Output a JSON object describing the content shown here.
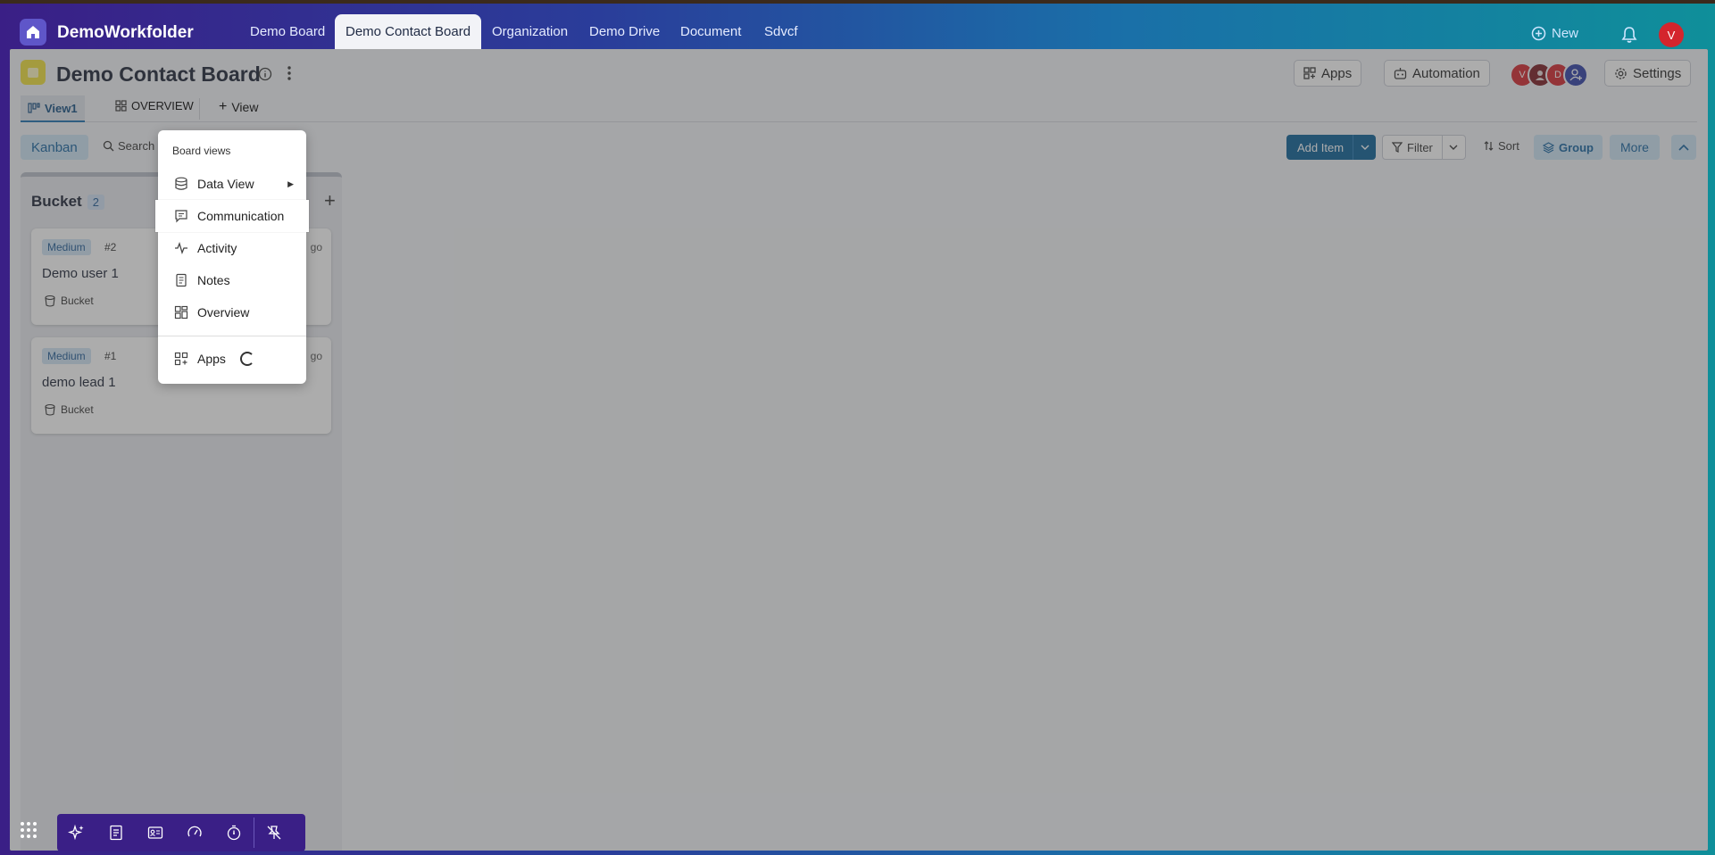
{
  "nav": {
    "brand": "DemoWorkfolder",
    "tabs": [
      {
        "label": "Demo Board"
      },
      {
        "label": "Demo Contact Board"
      },
      {
        "label": "Organization"
      },
      {
        "label": "Demo Drive"
      },
      {
        "label": "Document"
      },
      {
        "label": "Sdvcf"
      }
    ],
    "new_label": "New",
    "user_initial": "V"
  },
  "board": {
    "title": "Demo Contact Board",
    "apps_label": "Apps",
    "automation_label": "Automation",
    "settings_label": "Settings",
    "members": [
      {
        "initial": "V",
        "color": "#d4252d"
      },
      {
        "initial": "",
        "color": "#7a1b22"
      },
      {
        "initial": "D",
        "color": "#d4252d"
      },
      {
        "initial": "",
        "color": "#2f3fa6"
      }
    ]
  },
  "views": {
    "tabs": [
      {
        "label": "View1"
      },
      {
        "label": "OVERVIEW"
      }
    ],
    "add_view_label": "View"
  },
  "toolbar": {
    "kanban_label": "Kanban",
    "search_label": "Search",
    "add_item_label": "Add Item",
    "filter_label": "Filter",
    "sort_label": "Sort",
    "group_label": "Group",
    "more_label": "More"
  },
  "column": {
    "title": "Bucket",
    "count": "2",
    "cards": [
      {
        "priority": "Medium",
        "number": "#2",
        "time": "go",
        "title": "Demo user 1",
        "bucket": "Bucket"
      },
      {
        "priority": "Medium",
        "number": "#1",
        "time": "go",
        "title": "demo lead 1",
        "bucket": "Bucket"
      }
    ]
  },
  "menu": {
    "header": "Board views",
    "items": [
      {
        "label": "Data View"
      },
      {
        "label": "Communication"
      },
      {
        "label": "Activity"
      },
      {
        "label": "Notes"
      },
      {
        "label": "Overview"
      }
    ],
    "apps_label": "Apps"
  }
}
